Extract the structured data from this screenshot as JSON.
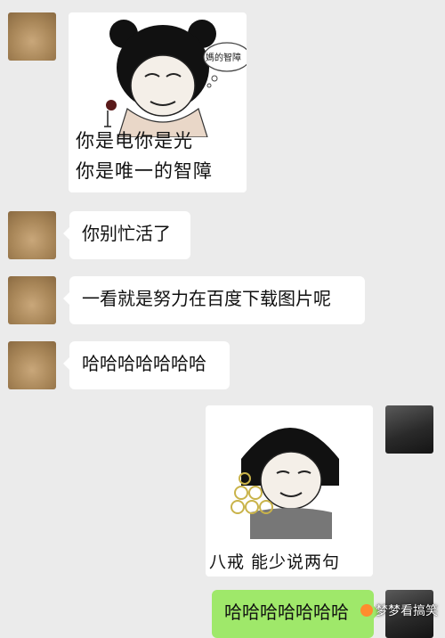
{
  "messages": [
    {
      "side": "left",
      "kind": "sticker",
      "caption_lines": [
        "你是电你是光",
        "你是唯一的智障"
      ],
      "bubble_text": "媽的智障"
    },
    {
      "side": "left",
      "kind": "text",
      "text": "你别忙活了"
    },
    {
      "side": "left",
      "kind": "text",
      "text": "一看就是努力在百度下载图片呢"
    },
    {
      "side": "left",
      "kind": "text",
      "text": "哈哈哈哈哈哈哈"
    },
    {
      "side": "right",
      "kind": "sticker",
      "caption": "八戒 能少说两句吧？"
    },
    {
      "side": "right",
      "kind": "text",
      "text": "哈哈哈哈哈哈哈"
    }
  ],
  "watermark": "梦梦看搞笑",
  "colors": {
    "background": "#ebebeb",
    "left_bubble": "#ffffff",
    "right_bubble": "#9fe86a"
  }
}
